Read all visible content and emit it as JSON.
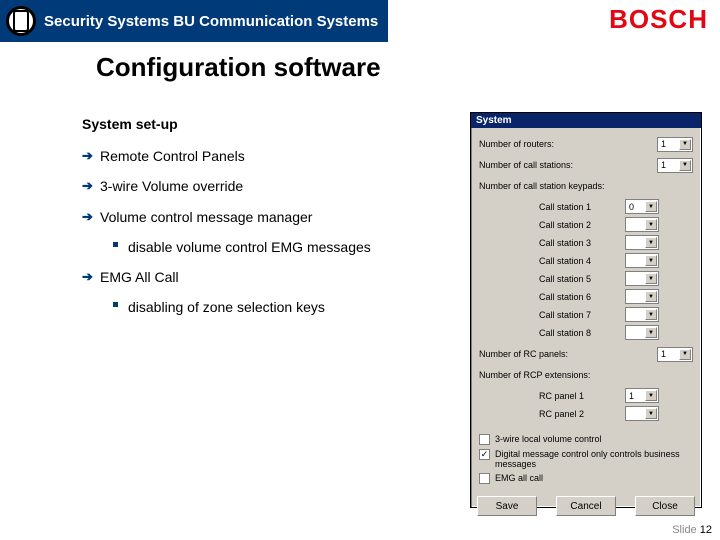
{
  "header": {
    "title": "Security Systems BU Communication Systems",
    "brand": "BOSCH"
  },
  "slide": {
    "title": "Configuration software",
    "subhead": "System set-up",
    "bullets": {
      "b1": "Remote Control Panels",
      "b2": "3-wire Volume override",
      "b3": "Volume control message manager",
      "b3_sub": "disable volume control EMG messages",
      "b4": "EMG All Call",
      "b4_sub": "disabling of zone selection keys"
    }
  },
  "dialog": {
    "title": "System",
    "num_routers_label": "Number of routers:",
    "num_routers_value": "1",
    "num_cs_label": "Number of call stations:",
    "num_cs_value": "1",
    "num_kp_label": "Number of call station keypads:",
    "cs": {
      "r1": "Call station 1",
      "v1": "0",
      "r2": "Call station 2",
      "v2": "",
      "r3": "Call station 3",
      "v3": "",
      "r4": "Call station 4",
      "v4": "",
      "r5": "Call station 5",
      "v5": "",
      "r6": "Call station 6",
      "v6": "",
      "r7": "Call station 7",
      "v7": "",
      "r8": "Call station 8",
      "v8": ""
    },
    "rc_groups_label": "Number of RC panels:",
    "rc_groups_value": "1",
    "rcp_ext_label": "Number of RCP extensions:",
    "rcp1": "RC panel 1",
    "rcp1_v": "1",
    "rcp2": "RC panel 2",
    "rcp2_v": "",
    "chk1_label": "3-wire local volume control",
    "chk2_label": "Digital message control only controls business messages",
    "chk3_label": "EMG all call",
    "btn_save": "Save",
    "btn_cancel": "Cancel",
    "btn_close": "Close"
  },
  "footer": {
    "label": "Slide",
    "num": "12"
  }
}
